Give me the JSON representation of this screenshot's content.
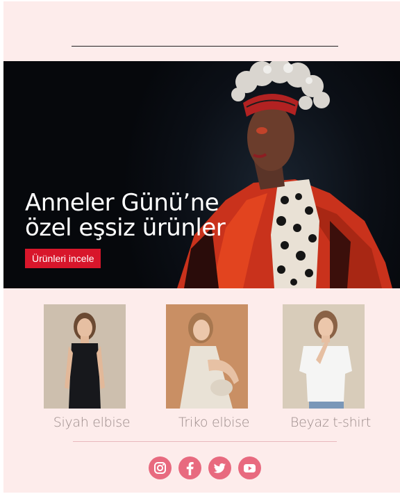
{
  "hero": {
    "title_line1": "Anneler Günü’ne",
    "title_line2": "özel eşsiz ürünler",
    "cta_label": "Ürünleri incele"
  },
  "products": [
    {
      "label": "Siyah elbise"
    },
    {
      "label": "Triko elbise"
    },
    {
      "label": "Beyaz t-shirt"
    }
  ],
  "social": {
    "icons": [
      "instagram-icon",
      "facebook-icon",
      "twitter-icon",
      "youtube-icon"
    ]
  },
  "colors": {
    "background": "#fdeceb",
    "cta": "#d8162b",
    "social": "#e86a7f",
    "divider": "#e9b7bd"
  }
}
